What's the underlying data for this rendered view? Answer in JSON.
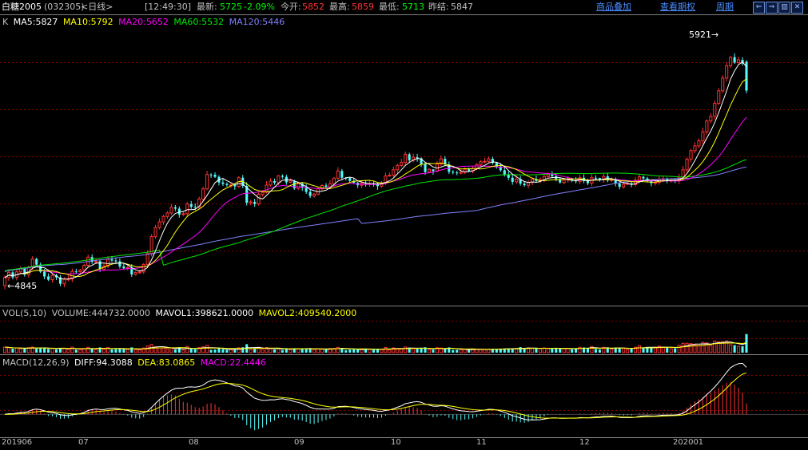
{
  "header": {
    "symbol": "白糖2005",
    "code": "(032305)",
    "period": "<日线>",
    "time": "[12:49:30]",
    "latest_label": "最新:",
    "latest": "5725",
    "change": "-2.09%",
    "open_label": "今开:",
    "open": "5852",
    "high_label": "最高:",
    "high": "5859",
    "low_label": "最低:",
    "low": "5713",
    "prev_label": "昨结:",
    "prev": "5847",
    "menu_overlay": "商品叠加",
    "menu_term": "查看期权",
    "menu_period": "周期"
  },
  "colors": {
    "up": "#ff3232",
    "down": "#54fcfc",
    "ma5": "#ffffff",
    "ma10": "#ffff00",
    "ma20": "#ff00ff",
    "ma60": "#00e600",
    "ma120": "#8080ff",
    "grid": "#800000",
    "axis": "#c0c0c0"
  },
  "price_legend": {
    "k": "K",
    "ma5": "MA5:5827",
    "ma10": "MA10:5792",
    "ma20": "MA20:5652",
    "ma60": "MA60:5532",
    "ma120": "MA120:5446"
  },
  "vol_legend": {
    "name": "VOL(5,10)",
    "volume": "VOLUME:444732.0000",
    "mavol1": "MAVOL1:398621.0000",
    "mavol2": "MAVOL2:409540.2000"
  },
  "macd_legend": {
    "name": "MACD(12,26,9)",
    "diff": "DIFF:94.3088",
    "dea": "DEA:83.0865",
    "macd": "MACD:22.4446"
  },
  "annotations": {
    "high_mark": "5921→",
    "low_mark": "←4845"
  },
  "x_labels": [
    "201906",
    "07",
    "08",
    "09",
    "10",
    "11",
    "12",
    "202001"
  ],
  "chart_data": {
    "type": "candlestick",
    "price_range": [
      4780,
      5990
    ],
    "period_high": 5921,
    "period_low": 4845,
    "candles": [
      [
        4868,
        4903,
        4852,
        4912
      ],
      [
        4903,
        4926,
        4889,
        4940
      ],
      [
        4926,
        4904,
        4895,
        4932
      ],
      [
        4904,
        4928,
        4891,
        4938
      ],
      [
        4928,
        4942,
        4917,
        4953
      ],
      [
        4942,
        4916,
        4907,
        4949
      ],
      [
        4916,
        4949,
        4903,
        4955
      ],
      [
        4949,
        4985,
        4937,
        4997
      ],
      [
        4985,
        4960,
        4950,
        4991
      ],
      [
        4960,
        4929,
        4923,
        4969
      ],
      [
        4929,
        4908,
        4896,
        4941
      ],
      [
        4908,
        4894,
        4888,
        4921
      ],
      [
        4894,
        4913,
        4881,
        4924
      ],
      [
        4913,
        4904,
        4892,
        4920
      ],
      [
        4904,
        4876,
        4865,
        4914
      ],
      [
        4876,
        4896,
        4861,
        4905
      ],
      [
        4896,
        4897,
        4886,
        4913
      ],
      [
        4897,
        4930,
        4883,
        4943
      ],
      [
        4930,
        4929,
        4918,
        4942
      ],
      [
        4929,
        4936,
        4917,
        4942
      ],
      [
        4936,
        4957,
        4924,
        4964
      ],
      [
        4957,
        4993,
        4948,
        5004
      ],
      [
        4993,
        4972,
        4963,
        5005
      ],
      [
        4972,
        4975,
        4963,
        4988
      ],
      [
        4975,
        4940,
        4928,
        4983
      ],
      [
        4940,
        4953,
        4932,
        4965
      ],
      [
        4953,
        4983,
        4945,
        4997
      ],
      [
        4983,
        4978,
        4972,
        4998
      ],
      [
        4978,
        4974,
        4962,
        4991
      ],
      [
        4974,
        4952,
        4943,
        4987
      ],
      [
        4952,
        4944,
        4938,
        4967
      ],
      [
        4944,
        4947,
        4935,
        4961
      ],
      [
        4947,
        4917,
        4906,
        4962
      ],
      [
        4917,
        4925,
        4911,
        4931
      ],
      [
        4925,
        4928,
        4919,
        4937
      ],
      [
        4928,
        4961,
        4919,
        4966
      ],
      [
        4961,
        5009,
        4946,
        5023
      ],
      [
        5009,
        5083,
        4996,
        5094
      ],
      [
        5083,
        5123,
        5073,
        5135
      ],
      [
        5123,
        5148,
        5115,
        5163
      ],
      [
        5148,
        5172,
        5135,
        5179
      ],
      [
        5172,
        5187,
        5162,
        5195
      ],
      [
        5187,
        5212,
        5178,
        5227
      ],
      [
        5212,
        5206,
        5195,
        5222
      ],
      [
        5206,
        5180,
        5167,
        5216
      ],
      [
        5180,
        5184,
        5174,
        5192
      ],
      [
        5184,
        5226,
        5169,
        5236
      ],
      [
        5226,
        5214,
        5205,
        5240
      ],
      [
        5214,
        5212,
        5199,
        5229
      ],
      [
        5212,
        5248,
        5204,
        5259
      ],
      [
        5248,
        5293,
        5239,
        5303
      ],
      [
        5293,
        5356,
        5287,
        5372
      ],
      [
        5356,
        5355,
        5341,
        5362
      ],
      [
        5355,
        5346,
        5341,
        5366
      ],
      [
        5346,
        5321,
        5308,
        5353
      ],
      [
        5321,
        5315,
        5306,
        5337
      ],
      [
        5315,
        5310,
        5302,
        5321
      ],
      [
        5310,
        5310,
        5297,
        5319
      ],
      [
        5310,
        5304,
        5289,
        5312
      ],
      [
        5304,
        5342,
        5297,
        5348
      ],
      [
        5342,
        5306,
        5296,
        5354
      ],
      [
        5306,
        5232,
        5220,
        5322
      ],
      [
        5232,
        5236,
        5221,
        5244
      ],
      [
        5236,
        5227,
        5214,
        5249
      ],
      [
        5227,
        5269,
        5219,
        5277
      ],
      [
        5269,
        5278,
        5260,
        5283
      ],
      [
        5278,
        5310,
        5273,
        5327
      ],
      [
        5310,
        5327,
        5303,
        5340
      ],
      [
        5327,
        5320,
        5311,
        5338
      ],
      [
        5320,
        5350,
        5310,
        5354
      ],
      [
        5350,
        5346,
        5338,
        5357
      ],
      [
        5346,
        5322,
        5311,
        5355
      ],
      [
        5322,
        5328,
        5318,
        5339
      ],
      [
        5328,
        5295,
        5289,
        5333
      ],
      [
        5295,
        5316,
        5287,
        5325
      ],
      [
        5316,
        5298,
        5284,
        5323
      ],
      [
        5298,
        5280,
        5271,
        5314
      ],
      [
        5280,
        5262,
        5253,
        5290
      ],
      [
        5262,
        5270,
        5254,
        5276
      ],
      [
        5270,
        5294,
        5265,
        5301
      ],
      [
        5294,
        5308,
        5286,
        5313
      ],
      [
        5308,
        5302,
        5293,
        5318
      ],
      [
        5302,
        5315,
        5291,
        5331
      ],
      [
        5315,
        5340,
        5303,
        5344
      ],
      [
        5340,
        5372,
        5332,
        5388
      ],
      [
        5372,
        5342,
        5332,
        5380
      ],
      [
        5342,
        5341,
        5330,
        5345
      ],
      [
        5341,
        5328,
        5320,
        5343
      ],
      [
        5328,
        5320,
        5314,
        5341
      ],
      [
        5320,
        5309,
        5297,
        5324
      ],
      [
        5309,
        5319,
        5296,
        5328
      ],
      [
        5319,
        5316,
        5303,
        5330
      ],
      [
        5316,
        5317,
        5302,
        5333
      ],
      [
        5317,
        5316,
        5303,
        5326
      ],
      [
        5316,
        5305,
        5289,
        5323
      ],
      [
        5305,
        5319,
        5298,
        5328
      ],
      [
        5319,
        5350,
        5310,
        5364
      ],
      [
        5350,
        5353,
        5346,
        5365
      ],
      [
        5353,
        5377,
        5344,
        5392
      ],
      [
        5377,
        5396,
        5363,
        5404
      ],
      [
        5396,
        5409,
        5388,
        5426
      ],
      [
        5409,
        5445,
        5395,
        5457
      ],
      [
        5445,
        5419,
        5406,
        5452
      ],
      [
        5419,
        5432,
        5410,
        5448
      ],
      [
        5432,
        5427,
        5412,
        5447
      ],
      [
        5427,
        5402,
        5389,
        5432
      ],
      [
        5402,
        5367,
        5355,
        5412
      ],
      [
        5367,
        5379,
        5364,
        5384
      ],
      [
        5379,
        5371,
        5355,
        5379
      ],
      [
        5371,
        5402,
        5365,
        5416
      ],
      [
        5402,
        5425,
        5394,
        5440
      ],
      [
        5425,
        5401,
        5395,
        5437
      ],
      [
        5401,
        5368,
        5359,
        5414
      ],
      [
        5368,
        5365,
        5357,
        5376
      ],
      [
        5365,
        5362,
        5353,
        5373
      ],
      [
        5362,
        5366,
        5356,
        5378
      ],
      [
        5366,
        5379,
        5358,
        5387
      ],
      [
        5379,
        5372,
        5366,
        5387
      ],
      [
        5372,
        5383,
        5361,
        5393
      ],
      [
        5383,
        5400,
        5376,
        5406
      ],
      [
        5400,
        5412,
        5394,
        5420
      ],
      [
        5412,
        5414,
        5406,
        5429
      ],
      [
        5414,
        5425,
        5406,
        5436
      ],
      [
        5425,
        5407,
        5400,
        5434
      ],
      [
        5407,
        5391,
        5382,
        5410
      ],
      [
        5391,
        5375,
        5368,
        5406
      ],
      [
        5375,
        5356,
        5347,
        5386
      ],
      [
        5356,
        5342,
        5331,
        5370
      ],
      [
        5342,
        5324,
        5311,
        5354
      ],
      [
        5324,
        5336,
        5315,
        5351
      ],
      [
        5336,
        5316,
        5307,
        5350
      ],
      [
        5316,
        5309,
        5302,
        5326
      ],
      [
        5309,
        5321,
        5296,
        5332
      ],
      [
        5321,
        5336,
        5309,
        5341
      ],
      [
        5336,
        5328,
        5322,
        5351
      ],
      [
        5328,
        5333,
        5318,
        5343
      ],
      [
        5333,
        5347,
        5322,
        5355
      ],
      [
        5347,
        5356,
        5338,
        5365
      ],
      [
        5356,
        5349,
        5341,
        5371
      ],
      [
        5349,
        5336,
        5326,
        5358
      ],
      [
        5336,
        5321,
        5316,
        5342
      ],
      [
        5321,
        5331,
        5313,
        5340
      ],
      [
        5331,
        5335,
        5320,
        5349
      ],
      [
        5335,
        5330,
        5323,
        5342
      ],
      [
        5330,
        5326,
        5317,
        5345
      ],
      [
        5326,
        5342,
        5313,
        5355
      ],
      [
        5342,
        5327,
        5318,
        5357
      ],
      [
        5327,
        5318,
        5309,
        5338
      ],
      [
        5318,
        5342,
        5305,
        5357
      ],
      [
        5342,
        5341,
        5331,
        5353
      ],
      [
        5341,
        5333,
        5325,
        5342
      ],
      [
        5333,
        5348,
        5320,
        5361
      ],
      [
        5348,
        5330,
        5322,
        5363
      ],
      [
        5330,
        5336,
        5324,
        5344
      ],
      [
        5336,
        5317,
        5304,
        5343
      ],
      [
        5317,
        5302,
        5291,
        5323
      ],
      [
        5302,
        5313,
        5294,
        5326
      ],
      [
        5313,
        5318,
        5310,
        5323
      ],
      [
        5318,
        5312,
        5300,
        5329
      ],
      [
        5312,
        5331,
        5303,
        5345
      ],
      [
        5331,
        5346,
        5316,
        5358
      ],
      [
        5346,
        5339,
        5330,
        5352
      ],
      [
        5339,
        5327,
        5321,
        5346
      ],
      [
        5327,
        5318,
        5305,
        5327
      ],
      [
        5318,
        5322,
        5308,
        5336
      ],
      [
        5322,
        5336,
        5311,
        5348
      ],
      [
        5336,
        5337,
        5323,
        5352
      ],
      [
        5337,
        5329,
        5318,
        5343
      ],
      [
        5329,
        5330,
        5321,
        5336
      ],
      [
        5330,
        5328,
        5318,
        5336
      ],
      [
        5328,
        5344,
        5314,
        5359
      ],
      [
        5344,
        5377,
        5331,
        5394
      ],
      [
        5377,
        5424,
        5367,
        5431
      ],
      [
        5424,
        5461,
        5409,
        5469
      ],
      [
        5461,
        5482,
        5449,
        5498
      ],
      [
        5482,
        5504,
        5471,
        5515
      ],
      [
        5504,
        5544,
        5490,
        5562
      ],
      [
        5544,
        5592,
        5532,
        5599
      ],
      [
        5592,
        5612,
        5581,
        5626
      ],
      [
        5612,
        5669,
        5598,
        5682
      ],
      [
        5669,
        5724,
        5661,
        5736
      ],
      [
        5724,
        5780,
        5714,
        5793
      ],
      [
        5780,
        5834,
        5765,
        5850
      ],
      [
        5834,
        5872,
        5825,
        5876
      ],
      [
        5872,
        5848,
        5842,
        5889
      ],
      [
        5848,
        5860,
        5838,
        5874
      ],
      [
        5860,
        5844,
        5835,
        5872
      ],
      [
        5852,
        5725,
        5713,
        5859
      ]
    ],
    "volume_range": [
      0,
      600000
    ],
    "volume_ma": {
      "mavol1": 398621.0,
      "mavol2": 409540.2,
      "volume": 444732.0
    },
    "macd_range": [
      -60,
      120
    ],
    "macd_last": {
      "diff": 94.3088,
      "dea": 83.0865,
      "macd": 22.4446
    }
  }
}
